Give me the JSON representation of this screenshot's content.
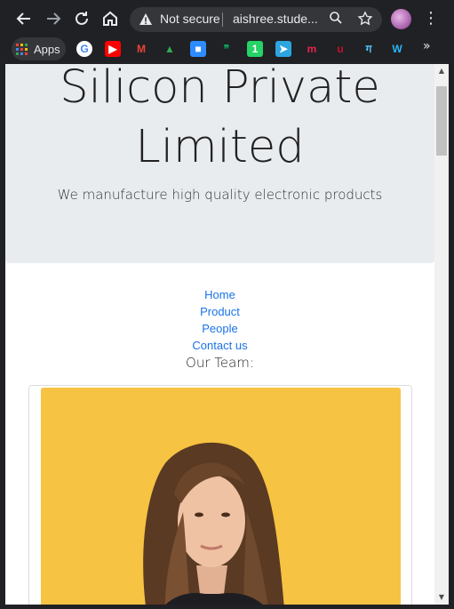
{
  "browser": {
    "security_status": "Not secure",
    "url": "aishree.stude...",
    "apps_label": "Apps",
    "bookmarks": [
      {
        "icon": "google-icon",
        "glyph": "G",
        "color": "#ffffff",
        "text_color": "#4285f4"
      },
      {
        "icon": "youtube-icon",
        "glyph": "▶",
        "color": "#ff0000",
        "text_color": "#ffffff"
      },
      {
        "icon": "gmail-icon",
        "glyph": "M",
        "color": "#202124",
        "text_color": "#ea4335"
      },
      {
        "icon": "google-drive-icon",
        "glyph": "▲",
        "color": "#202124",
        "text_color": "#34a853"
      },
      {
        "icon": "zoom-icon",
        "glyph": "■",
        "color": "#2d8cff",
        "text_color": "#ffffff"
      },
      {
        "icon": "hangouts-icon",
        "glyph": "❞",
        "color": "#202124",
        "text_color": "#0f9d58"
      },
      {
        "icon": "whatsapp-icon",
        "glyph": "1",
        "color": "#25d366",
        "text_color": "#ffffff"
      },
      {
        "icon": "telegram-icon",
        "glyph": "➤",
        "color": "#2ca5e0",
        "text_color": "#ffffff"
      },
      {
        "icon": "m-logo-icon",
        "glyph": "m",
        "color": "#202124",
        "text_color": "#e2264d"
      },
      {
        "icon": "u-logo-icon",
        "glyph": "u",
        "color": "#202124",
        "text_color": "#c8102e"
      },
      {
        "icon": "hindi-logo-icon",
        "glyph": "ग",
        "color": "#202124",
        "text_color": "#4fc3f7"
      },
      {
        "icon": "w-logo-icon",
        "glyph": "W",
        "color": "#202124",
        "text_color": "#29b6f6"
      }
    ]
  },
  "page": {
    "title": "Silicon Private Limited",
    "subtitle": "We manufacture high quality electronic products",
    "nav": [
      "Home",
      "Product",
      "People",
      "Contact us"
    ],
    "team_heading": "Our Team:"
  },
  "colors": {
    "jumbotron_bg": "#e9ecef",
    "link": "#1a73e8",
    "photo_bg": "#f6c343"
  }
}
